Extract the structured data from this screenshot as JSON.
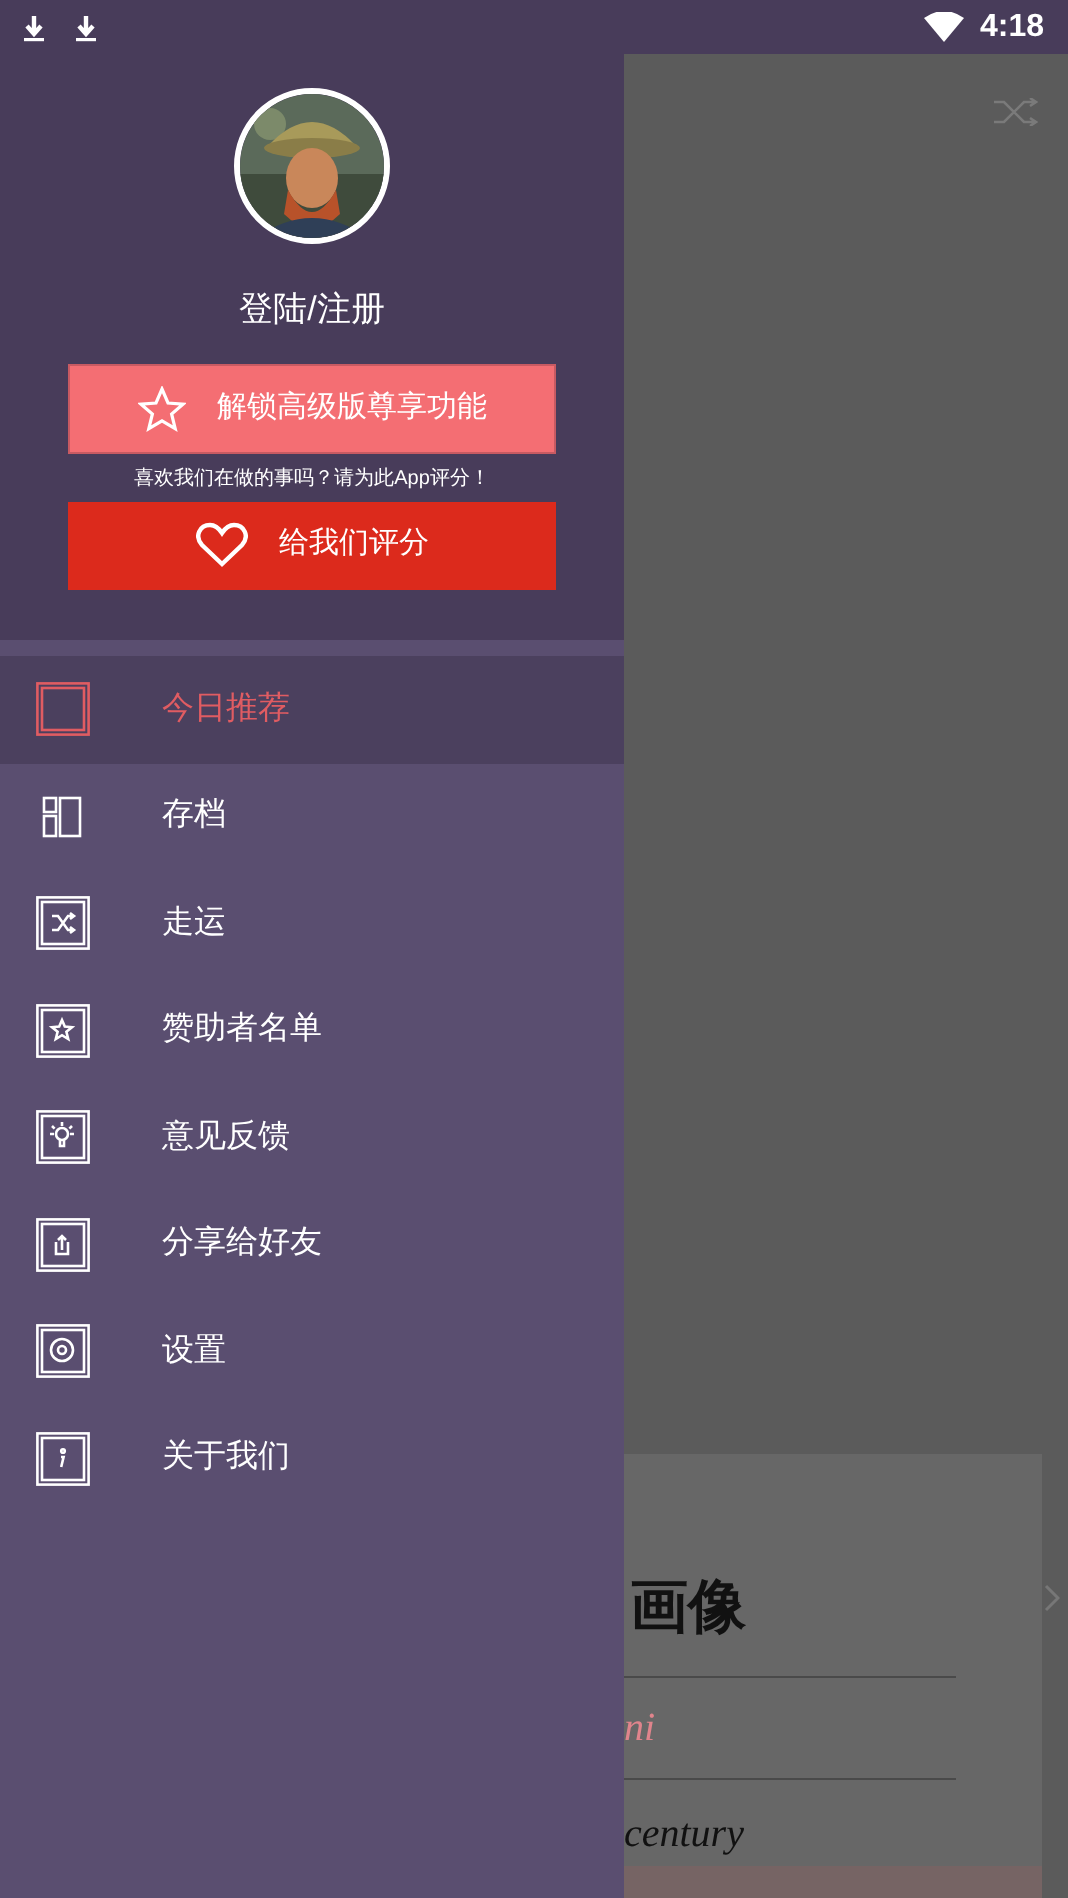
{
  "status_bar": {
    "time": "4:18"
  },
  "drawer": {
    "login": "登陆/注册",
    "premium_button": "解锁高级版尊享功能",
    "rate_prompt": "喜欢我们在做的事吗？请为此App评分！",
    "rate_button": "给我们评分",
    "items": [
      {
        "label": "今日推荐",
        "kind": "square",
        "selected": true
      },
      {
        "label": "存档",
        "kind": "archive",
        "selected": false
      },
      {
        "label": "走运",
        "kind": "shuffle",
        "selected": false
      },
      {
        "label": "赞助者名单",
        "kind": "star",
        "selected": false
      },
      {
        "label": "意见反馈",
        "kind": "bulb",
        "selected": false
      },
      {
        "label": "分享给好友",
        "kind": "share",
        "selected": false
      },
      {
        "label": "设置",
        "kind": "gear",
        "selected": false
      },
      {
        "label": "关于我们",
        "kind": "info",
        "selected": false
      }
    ]
  },
  "background_card": {
    "title": "画像",
    "subtitle": "ni",
    "line": "century"
  }
}
